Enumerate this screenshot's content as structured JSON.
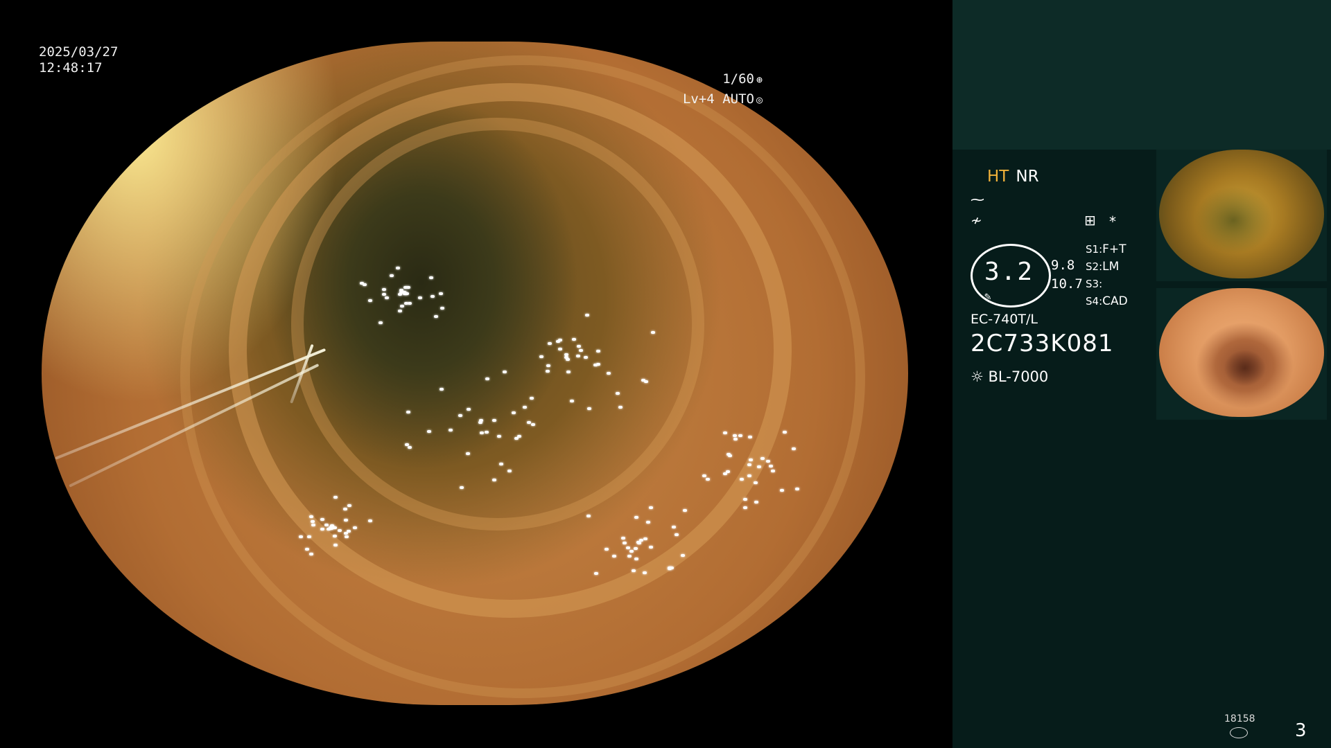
{
  "overlay": {
    "date": "2025/03/27",
    "time": "12:48:17",
    "shutter": "1/60",
    "shutter_icon": "aperture-icon",
    "level": "Lv+4",
    "mode": "AUTO",
    "mode_icon": "auto-exposure-icon"
  },
  "panel": {
    "ht_label": "HT",
    "nr_label": "NR",
    "ht_color": "#f2b23a",
    "panel_color": "#061c1a",
    "panel_top_color": "#0d2b27",
    "icon_a": "⁓",
    "icon_b": "≁",
    "memo_icon": "⊞",
    "star": "*",
    "value_main": "3.2",
    "value_1": "9.8",
    "value_2": "10.7",
    "slots": [
      {
        "key": "S1:",
        "value": "F+T"
      },
      {
        "key": "S2:",
        "value": "LM"
      },
      {
        "key": "S3:",
        "value": ""
      },
      {
        "key": "S4:",
        "value": "CAD"
      }
    ],
    "model": "EC-740T/L",
    "serial": "2C733K081",
    "light_icon": "☼",
    "light_source": "BL-7000",
    "image_count": "18158",
    "page_number": "3"
  }
}
